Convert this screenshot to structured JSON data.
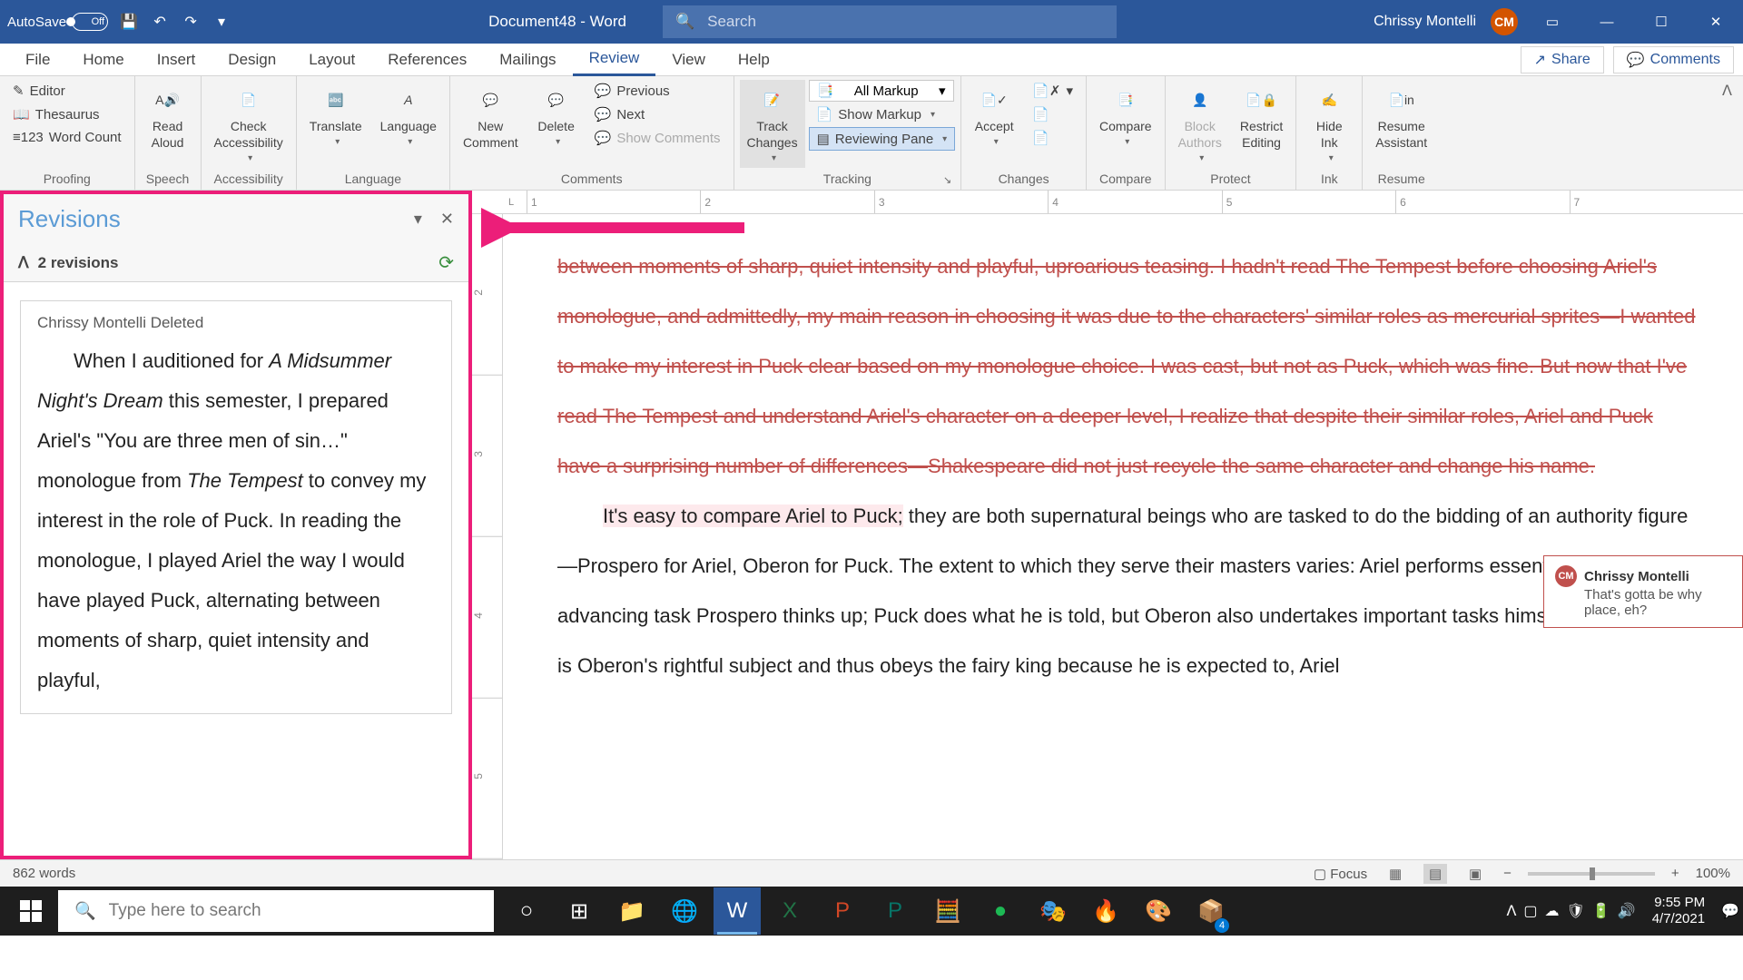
{
  "titlebar": {
    "autosave_label": "AutoSave",
    "autosave_state": "Off",
    "doc_title": "Document48 - Word",
    "search_placeholder": "Search",
    "user_name": "Chrissy Montelli",
    "user_initials": "CM"
  },
  "tabs": {
    "items": [
      "File",
      "Home",
      "Insert",
      "Design",
      "Layout",
      "References",
      "Mailings",
      "Review",
      "View",
      "Help"
    ],
    "active": "Review",
    "share": "Share",
    "comments": "Comments"
  },
  "ribbon": {
    "proofing": {
      "label": "Proofing",
      "editor": "Editor",
      "thesaurus": "Thesaurus",
      "word_count": "Word Count"
    },
    "speech": {
      "label": "Speech",
      "read_aloud": "Read\nAloud"
    },
    "accessibility": {
      "label": "Accessibility",
      "check": "Check\nAccessibility"
    },
    "language": {
      "label": "Language",
      "translate": "Translate",
      "language": "Language"
    },
    "comments": {
      "label": "Comments",
      "new": "New\nComment",
      "delete": "Delete",
      "previous": "Previous",
      "next": "Next",
      "show": "Show Comments"
    },
    "tracking": {
      "label": "Tracking",
      "track": "Track\nChanges",
      "markup_display": "All Markup",
      "show_markup": "Show Markup",
      "reviewing_pane": "Reviewing Pane"
    },
    "changes": {
      "label": "Changes",
      "accept": "Accept"
    },
    "compare": {
      "label": "Compare",
      "compare": "Compare"
    },
    "protect": {
      "label": "Protect",
      "block": "Block\nAuthors",
      "restrict": "Restrict\nEditing"
    },
    "ink": {
      "label": "Ink",
      "hide": "Hide\nInk"
    },
    "resume": {
      "label": "Resume",
      "assistant": "Resume\nAssistant"
    }
  },
  "revisions": {
    "title": "Revisions",
    "count_label": "2 revisions",
    "item": {
      "author_action": "Chrissy Montelli Deleted",
      "text_prefix": "When I auditioned for ",
      "text_italic1": "A Midsummer Night's Dream",
      "text_mid1": " this semester, I prepared Ariel's \"You are three men of sin…\" monologue from ",
      "text_italic2": "The Tempest",
      "text_mid2": " to convey my interest in the role of Puck. In reading the monologue, I played Ariel the way I would have played Puck, alternating between moments of sharp, quiet intensity and playful,"
    }
  },
  "document": {
    "deleted_para": "between moments of sharp, quiet intensity and playful, uproarious teasing. I hadn't read The Tempest before choosing Ariel's monologue, and admittedly, my main reason in choosing it was due to the characters' similar roles as mercurial sprites—I wanted to make my interest in Puck clear based on my monologue choice. I was cast, but not as Puck, which was fine. But now that I've read The Tempest and understand Ariel's character on a deeper level, I realize that despite their similar roles, Ariel and Puck have a surprising number of differences—Shakespeare did not just recycle the same character and change his name.",
    "body_highlight": "It's easy to compare Ariel to Puck;",
    "body_rest": " they are both supernatural beings who are tasked to do the bidding of an authority figure—Prospero for Ariel, Oberon for Puck. The extent to which they serve their masters varies: Ariel performs essentially every plot-advancing task Prospero thinks up; Puck does what he is told, but Oberon also undertakes important tasks himself. While Puck is Oberon's rightful subject and thus obeys the fairy king because he is expected to, Ariel"
  },
  "comment": {
    "author": "Chrissy Montelli",
    "initials": "CM",
    "text": "That's gotta be why place, eh?"
  },
  "statusbar": {
    "words": "862 words",
    "focus": "Focus",
    "zoom": "100%"
  },
  "taskbar": {
    "search_placeholder": "Type here to search",
    "time": "9:55 PM",
    "date": "4/7/2021",
    "badge": "4"
  },
  "ruler_h": [
    "1",
    "2",
    "3",
    "4",
    "5",
    "6",
    "7"
  ],
  "ruler_v": [
    "2",
    "3",
    "4",
    "5"
  ]
}
